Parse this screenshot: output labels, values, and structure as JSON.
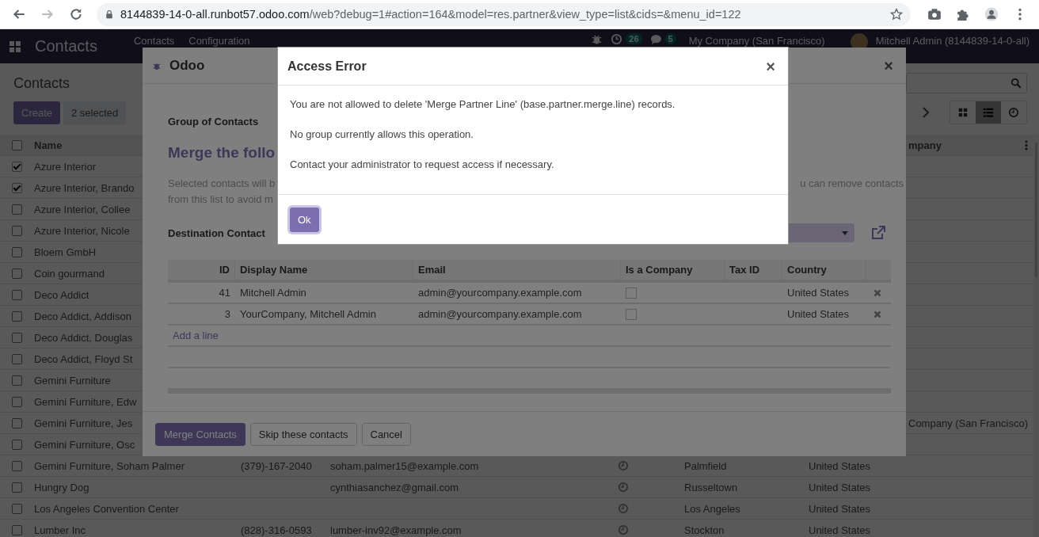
{
  "browser": {
    "url_host": "8144839-14-0-all.runbot57.odoo.com",
    "url_path": "/web?debug=1#action=164&model=res.partner&view_type=list&cids=&menu_id=122"
  },
  "navbar": {
    "app_name": "Contacts",
    "menus": [
      "Contacts",
      "Configuration"
    ],
    "activity_count": "26",
    "message_count": "5",
    "company": "My Company (San Francisco)",
    "user": "Mitchell Admin (8144839-14-0-all)"
  },
  "control_panel": {
    "breadcrumb": "Contacts",
    "create_button": "Create",
    "selection": "2 selected",
    "views": [
      {
        "kind": "kanban",
        "selected": false
      },
      {
        "kind": "list",
        "selected": true
      },
      {
        "kind": "activity",
        "selected": false
      }
    ]
  },
  "list": {
    "select_all": false,
    "columns": {
      "name": "Name",
      "company": "mpany"
    },
    "rows": [
      {
        "name": "Azure Interior",
        "checked": true
      },
      {
        "name": "Azure Interior, Brando",
        "checked": true
      },
      {
        "name": "Azure Interior, Collee",
        "checked": false
      },
      {
        "name": "Azure Interior, Nicole",
        "checked": false
      },
      {
        "name": "Bloem GmbH",
        "checked": false
      },
      {
        "name": "Coin gourmand",
        "checked": false
      },
      {
        "name": "Deco Addict",
        "checked": false
      },
      {
        "name": "Deco Addict, Addison",
        "checked": false
      },
      {
        "name": "Deco Addict, Douglas",
        "checked": false
      },
      {
        "name": "Deco Addict, Floyd St",
        "checked": false
      },
      {
        "name": "Gemini Furniture",
        "checked": false
      },
      {
        "name": "Gemini Furniture, Edw",
        "checked": false
      },
      {
        "name": "Gemini Furniture, Jes",
        "company": "Company (San Francisco)",
        "checked": false
      },
      {
        "name": "Gemini Furniture, Osc",
        "checked": false
      },
      {
        "name": "Gemini Furniture, Soham Palmer",
        "phone": "(379)-167-2040",
        "email": "soham.palmer15@example.com",
        "city": "Palmfield",
        "country": "United States",
        "checked": false
      },
      {
        "name": "Hungry Dog",
        "email": "cynthiasanchez@gmail.com",
        "city": "Russeltown",
        "country": "United States",
        "checked": false
      },
      {
        "name": "Los Angeles Convention Center",
        "city": "Los Angeles",
        "country": "United States",
        "checked": false
      },
      {
        "name": "Lumber Inc",
        "phone": "(828)-316-0593",
        "email": "lumber-inv92@example.com",
        "city": "Stockton",
        "country": "United States",
        "checked": false
      }
    ]
  },
  "merge_dialog": {
    "title": "Odoo",
    "close": "×",
    "group_label": "Group of Contacts",
    "heading": "Merge the follo",
    "description_left": [
      "Selected contacts will b",
      "from this list to avoid m"
    ],
    "description_right": "u can remove contacts",
    "destination_label": "Destination Contact",
    "table": {
      "columns": [
        "ID",
        "Display Name",
        "Email",
        "Is a Company",
        "Tax ID",
        "Country"
      ],
      "rows": [
        {
          "id": "41",
          "display_name": "Mitchell Admin",
          "email": "admin@yourcompany.example.com",
          "is_company": false,
          "country": "United States"
        },
        {
          "id": "3",
          "display_name": "YourCompany, Mitchell Admin",
          "email": "admin@yourcompany.example.com",
          "is_company": false,
          "country": "United States"
        }
      ],
      "add_line": "Add a line"
    },
    "buttons": [
      {
        "label": "Merge Contacts",
        "kind": "primary"
      },
      {
        "label": "Skip these contacts",
        "kind": "secondary"
      },
      {
        "label": "Cancel",
        "kind": "secondary"
      }
    ]
  },
  "error_dialog": {
    "title": "Access Error",
    "close": "×",
    "paragraphs": [
      "You are not allowed to delete 'Merge Partner Line' (base.partner.merge.line) records.",
      "No group currently allows this operation.",
      "Contact your administrator to request access if necessary."
    ],
    "button": "Ok"
  }
}
